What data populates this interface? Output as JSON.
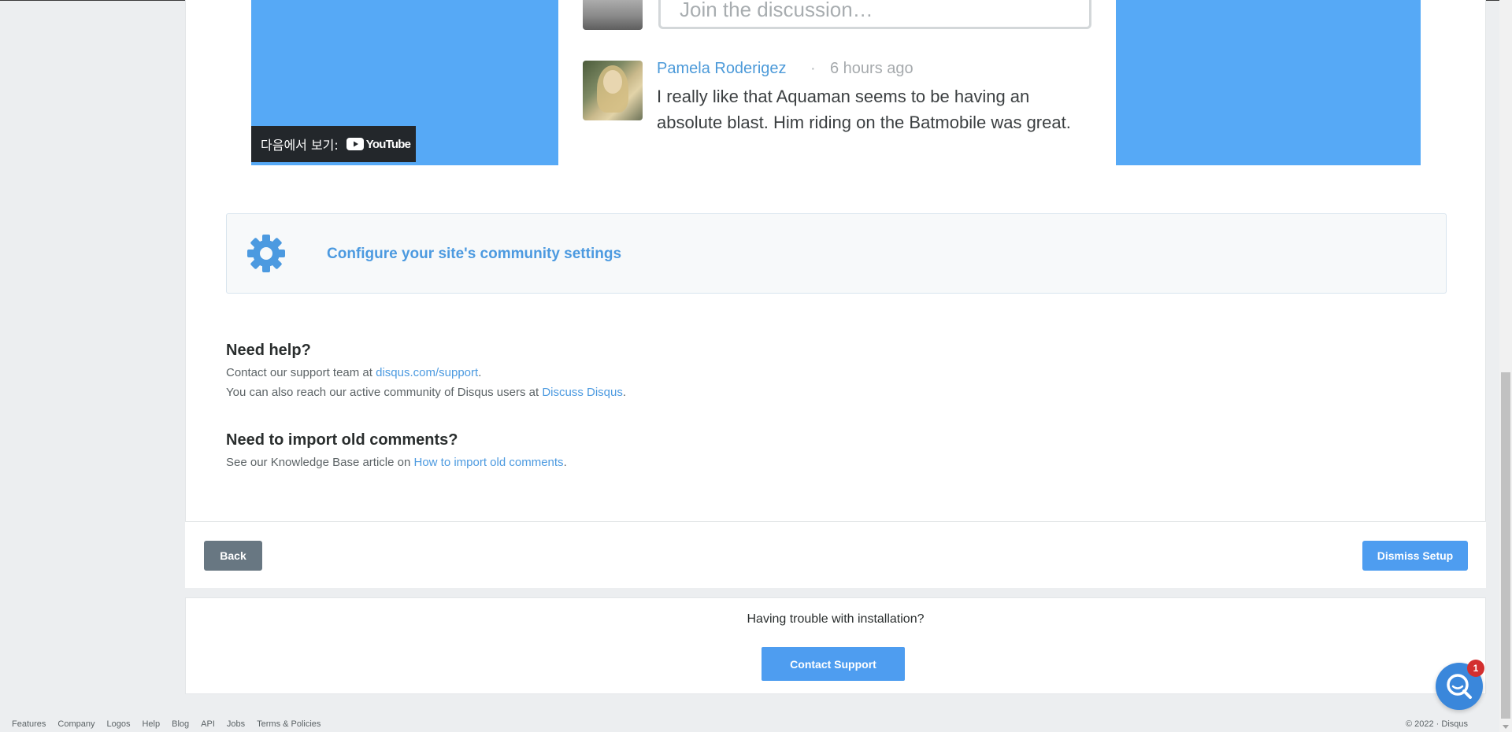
{
  "video": {
    "comment_placeholder": "Join the discussion…",
    "comment": {
      "author": "Pamela Roderigez",
      "separator": "·",
      "time": "6 hours ago",
      "text": "I really like that Aquaman seems to be having an absolute blast. Him riding on the Batmobile was great."
    },
    "watch_on_label": "다음에서 보기:",
    "youtube_label": "YouTube"
  },
  "settings": {
    "link_label": "Configure your site's community settings",
    "icon": "gear-icon"
  },
  "help": {
    "title": "Need help?",
    "line1_prefix": "Contact our support team at ",
    "line1_link": "disqus.com/support",
    "line1_suffix": ".",
    "line2_prefix": "You can also reach our active community of Disqus users at ",
    "line2_link": "Discuss Disqus",
    "line2_suffix": "."
  },
  "import": {
    "title": "Need to import old comments?",
    "prefix": "See our Knowledge Base article on ",
    "link": "How to import old comments",
    "suffix": "."
  },
  "actions": {
    "back_label": "Back",
    "dismiss_label": "Dismiss Setup"
  },
  "trouble": {
    "text": "Having trouble with installation?",
    "contact_label": "Contact Support"
  },
  "footer": {
    "links": [
      "Features",
      "Company",
      "Logos",
      "Help",
      "Blog",
      "API",
      "Jobs",
      "Terms & Policies"
    ],
    "copyright": "© 2022 · Disqus"
  },
  "chat": {
    "badge_count": "1",
    "icon": "search-chat-icon"
  },
  "colors": {
    "accent": "#4e9df0",
    "video_bg": "#56a9f6",
    "back_button": "#687782",
    "badge": "#d32f2f"
  }
}
